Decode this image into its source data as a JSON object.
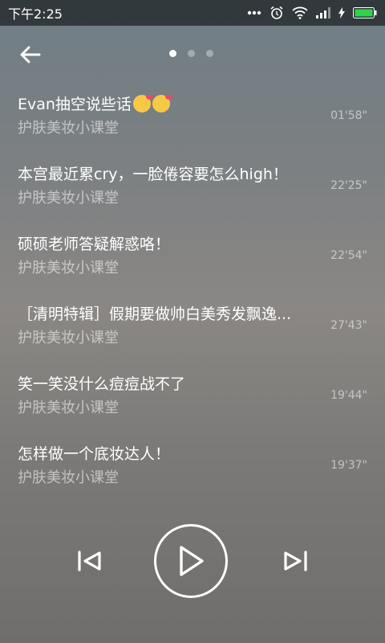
{
  "status_bar": {
    "time": "下午2:25",
    "icons": [
      "more-dots-icon",
      "alarm-icon",
      "wifi-icon",
      "signal-icon",
      "charging-icon",
      "battery-icon"
    ]
  },
  "header": {
    "back_icon": "arrow-left-icon",
    "page_count": 3,
    "active_page": 1
  },
  "episodes": [
    {
      "title": "Evan抽空说些话",
      "has_emoji": true,
      "subtitle": "护肤美妆小课堂",
      "duration": "01'58\""
    },
    {
      "title": "本宫最近累cry，一脸倦容要怎么high！",
      "has_emoji": false,
      "subtitle": "护肤美妆小课堂",
      "duration": "22'25\""
    },
    {
      "title": "硕硕老师答疑解惑咯！",
      "has_emoji": false,
      "subtitle": "护肤美妆小课堂",
      "duration": "22'54\""
    },
    {
      "title": "［清明特辑］假期要做帅白美秀发飘逸...",
      "has_emoji": false,
      "subtitle": "护肤美妆小课堂",
      "duration": "27'43\""
    },
    {
      "title": "笑一笑没什么痘痘战不了",
      "has_emoji": false,
      "subtitle": "护肤美妆小课堂",
      "duration": "19'44\""
    },
    {
      "title": "怎样做一个底妆达人！",
      "has_emoji": false,
      "subtitle": "护肤美妆小课堂",
      "duration": "19'37\""
    }
  ],
  "player": {
    "prev_icon": "skip-previous-icon",
    "play_icon": "play-icon",
    "next_icon": "skip-next-icon"
  }
}
